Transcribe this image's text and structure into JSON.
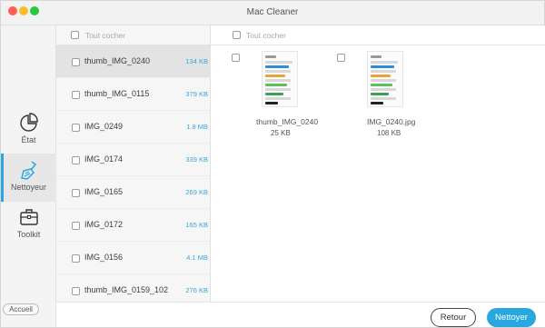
{
  "window": {
    "title": "Mac Cleaner"
  },
  "sidebar": {
    "items": [
      {
        "label": "État",
        "icon": "pie-chart-icon",
        "active": false
      },
      {
        "label": "Nettoyeur",
        "icon": "broom-icon",
        "active": true
      },
      {
        "label": "Toolkit",
        "icon": "toolbox-icon",
        "active": false
      }
    ],
    "home_label": "Accueil"
  },
  "list": {
    "select_all_label": "Tout cocher",
    "rows": [
      {
        "name": "thumb_IMG_0240",
        "size": "134 KB",
        "selected": true
      },
      {
        "name": "thumb_IMG_0115",
        "size": "379 KB",
        "selected": false
      },
      {
        "name": "IMG_0249",
        "size": "1.8 MB",
        "selected": false
      },
      {
        "name": "IMG_0174",
        "size": "339 KB",
        "selected": false
      },
      {
        "name": "IMG_0165",
        "size": "269 KB",
        "selected": false
      },
      {
        "name": "IMG_0172",
        "size": "165 KB",
        "selected": false
      },
      {
        "name": "IMG_0156",
        "size": "4.1 MB",
        "selected": false
      },
      {
        "name": "thumb_IMG_0159_102",
        "size": "276 KB",
        "selected": false
      }
    ]
  },
  "detail": {
    "select_all_label": "Tout cocher",
    "files": [
      {
        "name": "thumb_IMG_0240",
        "size": "25 KB"
      },
      {
        "name": "IMG_0240.jpg",
        "size": "108 KB"
      }
    ]
  },
  "footer": {
    "back_label": "Retour",
    "clean_label": "Nettoyer"
  },
  "colors": {
    "accent": "#29a8e0",
    "size_text": "#3aa5d8"
  }
}
